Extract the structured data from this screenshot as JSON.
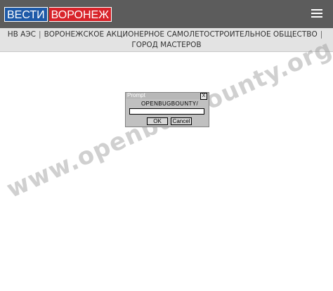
{
  "header": {
    "logo_part1": "ВЕСТИ",
    "logo_part2": "ВОРОНЕЖ",
    "menu_icon": "hamburger-menu-icon"
  },
  "nav": {
    "item1": "НВ АЭС",
    "item2": "ВОРОНЕЖСКОЕ АКЦИОНЕРНОЕ САМОЛЕТОСТРОИТЕЛЬНОЕ ОБЩЕСТВО",
    "item3": "ГОРОД МАСТЕРОВ",
    "separator": "|"
  },
  "watermark": "www.openbugbounty.org",
  "prompt_dialog": {
    "title": "Prompt",
    "close": "X",
    "message": "OPENBUGBOUNTY/",
    "input_value": "",
    "ok_label": "OK",
    "cancel_label": "Cancel"
  }
}
